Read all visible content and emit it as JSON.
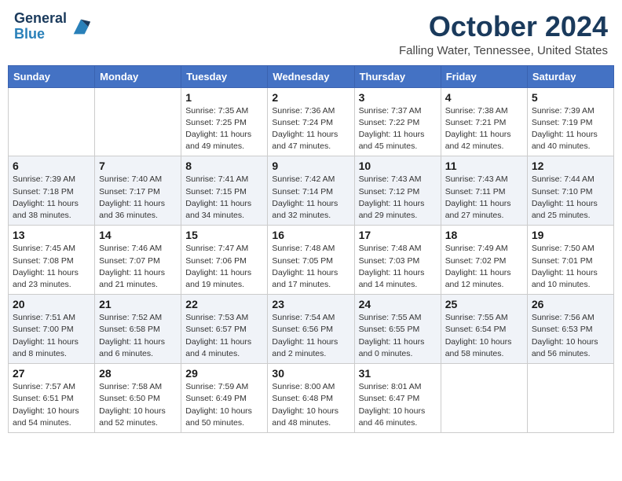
{
  "header": {
    "logo_line1": "General",
    "logo_line2": "Blue",
    "month_title": "October 2024",
    "location": "Falling Water, Tennessee, United States"
  },
  "days_of_week": [
    "Sunday",
    "Monday",
    "Tuesday",
    "Wednesday",
    "Thursday",
    "Friday",
    "Saturday"
  ],
  "weeks": [
    [
      {
        "day": "",
        "sunrise": "",
        "sunset": "",
        "daylight": ""
      },
      {
        "day": "",
        "sunrise": "",
        "sunset": "",
        "daylight": ""
      },
      {
        "day": "1",
        "sunrise": "Sunrise: 7:35 AM",
        "sunset": "Sunset: 7:25 PM",
        "daylight": "Daylight: 11 hours and 49 minutes."
      },
      {
        "day": "2",
        "sunrise": "Sunrise: 7:36 AM",
        "sunset": "Sunset: 7:24 PM",
        "daylight": "Daylight: 11 hours and 47 minutes."
      },
      {
        "day": "3",
        "sunrise": "Sunrise: 7:37 AM",
        "sunset": "Sunset: 7:22 PM",
        "daylight": "Daylight: 11 hours and 45 minutes."
      },
      {
        "day": "4",
        "sunrise": "Sunrise: 7:38 AM",
        "sunset": "Sunset: 7:21 PM",
        "daylight": "Daylight: 11 hours and 42 minutes."
      },
      {
        "day": "5",
        "sunrise": "Sunrise: 7:39 AM",
        "sunset": "Sunset: 7:19 PM",
        "daylight": "Daylight: 11 hours and 40 minutes."
      }
    ],
    [
      {
        "day": "6",
        "sunrise": "Sunrise: 7:39 AM",
        "sunset": "Sunset: 7:18 PM",
        "daylight": "Daylight: 11 hours and 38 minutes."
      },
      {
        "day": "7",
        "sunrise": "Sunrise: 7:40 AM",
        "sunset": "Sunset: 7:17 PM",
        "daylight": "Daylight: 11 hours and 36 minutes."
      },
      {
        "day": "8",
        "sunrise": "Sunrise: 7:41 AM",
        "sunset": "Sunset: 7:15 PM",
        "daylight": "Daylight: 11 hours and 34 minutes."
      },
      {
        "day": "9",
        "sunrise": "Sunrise: 7:42 AM",
        "sunset": "Sunset: 7:14 PM",
        "daylight": "Daylight: 11 hours and 32 minutes."
      },
      {
        "day": "10",
        "sunrise": "Sunrise: 7:43 AM",
        "sunset": "Sunset: 7:12 PM",
        "daylight": "Daylight: 11 hours and 29 minutes."
      },
      {
        "day": "11",
        "sunrise": "Sunrise: 7:43 AM",
        "sunset": "Sunset: 7:11 PM",
        "daylight": "Daylight: 11 hours and 27 minutes."
      },
      {
        "day": "12",
        "sunrise": "Sunrise: 7:44 AM",
        "sunset": "Sunset: 7:10 PM",
        "daylight": "Daylight: 11 hours and 25 minutes."
      }
    ],
    [
      {
        "day": "13",
        "sunrise": "Sunrise: 7:45 AM",
        "sunset": "Sunset: 7:08 PM",
        "daylight": "Daylight: 11 hours and 23 minutes."
      },
      {
        "day": "14",
        "sunrise": "Sunrise: 7:46 AM",
        "sunset": "Sunset: 7:07 PM",
        "daylight": "Daylight: 11 hours and 21 minutes."
      },
      {
        "day": "15",
        "sunrise": "Sunrise: 7:47 AM",
        "sunset": "Sunset: 7:06 PM",
        "daylight": "Daylight: 11 hours and 19 minutes."
      },
      {
        "day": "16",
        "sunrise": "Sunrise: 7:48 AM",
        "sunset": "Sunset: 7:05 PM",
        "daylight": "Daylight: 11 hours and 17 minutes."
      },
      {
        "day": "17",
        "sunrise": "Sunrise: 7:48 AM",
        "sunset": "Sunset: 7:03 PM",
        "daylight": "Daylight: 11 hours and 14 minutes."
      },
      {
        "day": "18",
        "sunrise": "Sunrise: 7:49 AM",
        "sunset": "Sunset: 7:02 PM",
        "daylight": "Daylight: 11 hours and 12 minutes."
      },
      {
        "day": "19",
        "sunrise": "Sunrise: 7:50 AM",
        "sunset": "Sunset: 7:01 PM",
        "daylight": "Daylight: 11 hours and 10 minutes."
      }
    ],
    [
      {
        "day": "20",
        "sunrise": "Sunrise: 7:51 AM",
        "sunset": "Sunset: 7:00 PM",
        "daylight": "Daylight: 11 hours and 8 minutes."
      },
      {
        "day": "21",
        "sunrise": "Sunrise: 7:52 AM",
        "sunset": "Sunset: 6:58 PM",
        "daylight": "Daylight: 11 hours and 6 minutes."
      },
      {
        "day": "22",
        "sunrise": "Sunrise: 7:53 AM",
        "sunset": "Sunset: 6:57 PM",
        "daylight": "Daylight: 11 hours and 4 minutes."
      },
      {
        "day": "23",
        "sunrise": "Sunrise: 7:54 AM",
        "sunset": "Sunset: 6:56 PM",
        "daylight": "Daylight: 11 hours and 2 minutes."
      },
      {
        "day": "24",
        "sunrise": "Sunrise: 7:55 AM",
        "sunset": "Sunset: 6:55 PM",
        "daylight": "Daylight: 11 hours and 0 minutes."
      },
      {
        "day": "25",
        "sunrise": "Sunrise: 7:55 AM",
        "sunset": "Sunset: 6:54 PM",
        "daylight": "Daylight: 10 hours and 58 minutes."
      },
      {
        "day": "26",
        "sunrise": "Sunrise: 7:56 AM",
        "sunset": "Sunset: 6:53 PM",
        "daylight": "Daylight: 10 hours and 56 minutes."
      }
    ],
    [
      {
        "day": "27",
        "sunrise": "Sunrise: 7:57 AM",
        "sunset": "Sunset: 6:51 PM",
        "daylight": "Daylight: 10 hours and 54 minutes."
      },
      {
        "day": "28",
        "sunrise": "Sunrise: 7:58 AM",
        "sunset": "Sunset: 6:50 PM",
        "daylight": "Daylight: 10 hours and 52 minutes."
      },
      {
        "day": "29",
        "sunrise": "Sunrise: 7:59 AM",
        "sunset": "Sunset: 6:49 PM",
        "daylight": "Daylight: 10 hours and 50 minutes."
      },
      {
        "day": "30",
        "sunrise": "Sunrise: 8:00 AM",
        "sunset": "Sunset: 6:48 PM",
        "daylight": "Daylight: 10 hours and 48 minutes."
      },
      {
        "day": "31",
        "sunrise": "Sunrise: 8:01 AM",
        "sunset": "Sunset: 6:47 PM",
        "daylight": "Daylight: 10 hours and 46 minutes."
      },
      {
        "day": "",
        "sunrise": "",
        "sunset": "",
        "daylight": ""
      },
      {
        "day": "",
        "sunrise": "",
        "sunset": "",
        "daylight": ""
      }
    ]
  ]
}
